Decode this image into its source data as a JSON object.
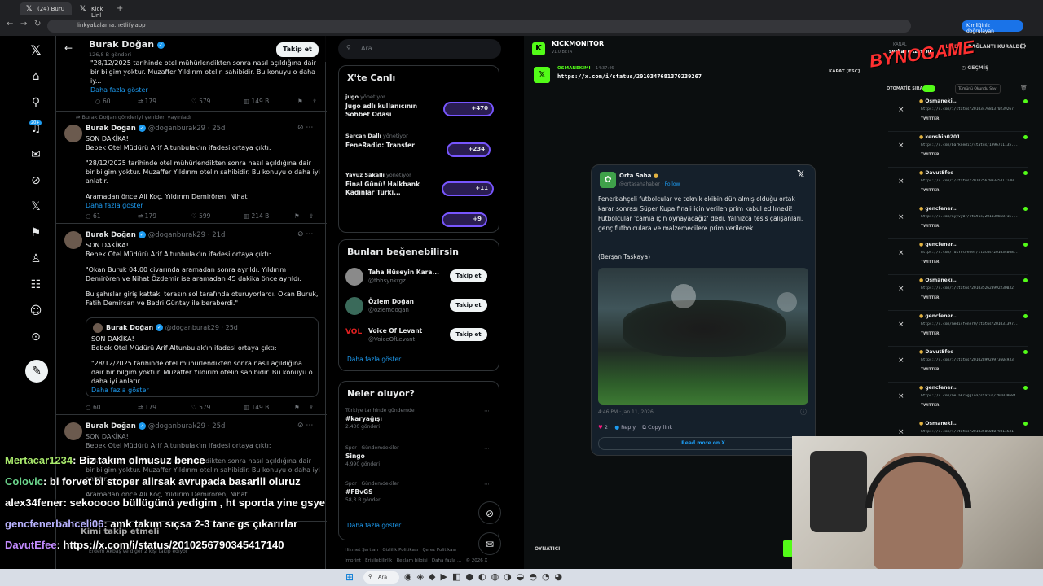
{
  "browser": {
    "tabs": [
      {
        "label": "(24) Buru"
      },
      {
        "label": "Kick Linl"
      }
    ],
    "url": "linkyakalama.netlify.app",
    "profile": "Kimliğiniz doğrulayan"
  },
  "timeline": {
    "header_name": "Burak Doğan",
    "header_sub": "126,8 B gönderi",
    "follow_label": "Takip et",
    "top_text": "\"28/12/2025 tarihinde otel mühürlendikten sonra nasıl açıldığına dair bir bilgim yoktur. Muzaffer Yıldırım otelin sahibidir. Bu konuyu o daha iy...",
    "top_more": "Daha fazla göster",
    "top_stats": {
      "replies": "60",
      "reposts": "179",
      "likes": "579",
      "views": "149 B"
    },
    "reposted_by": "Burak Doğan gönderiyi yeniden yayınladı",
    "tweets": [
      {
        "name": "Burak Doğan",
        "handle": "@doganburak29 · 25d",
        "line1": "SON DAKİKA!",
        "line2": "Bebek Otel Müdürü Arif Altunbulak'ın ifadesi ortaya çıktı:",
        "body": "\"28/12/2025 tarihinde otel mühürlendikten sonra nasıl açıldığına dair bir bilgim yoktur. Muzaffer Yıldırım otelin sahibidir. Bu konuyu o daha iyi anlatır.",
        "body2": "Aramadan önce Ali Koç, Yıldırım Demirören, Nihat",
        "more": "Daha fazla göster",
        "stats": {
          "replies": "61",
          "reposts": "179",
          "likes": "599",
          "views": "214 B"
        }
      },
      {
        "name": "Burak Doğan",
        "handle": "@doganburak29 · 21d",
        "line1": "SON DAKİKA!",
        "line2": "Bebek Otel Müdürü Arif Altunbulak'ın ifadesi ortaya çıktı:",
        "body": "\"Okan Buruk 04:00 civarında aramadan sonra ayrıldı. Yıldırım Demirören ve Nihat Özdemir ise aramadan 45 dakika önce ayrıldı.",
        "body2": "Bu şahıslar giriş kattaki terasın sol tarafında oturuyorlardı. Okan Buruk, Fatih Demircan ve Bedri Güntay ile beraberdi.\"",
        "quote": {
          "name": "Burak Doğan",
          "handle": "@doganburak29 · 25d",
          "line1": "SON DAKİKA!",
          "line2": "Bebek Otel Müdürü Arif Altunbulak'ın ifadesi ortaya çıktı:",
          "body": "\"28/12/2025 tarihinde otel mühürlendikten sonra nasıl açıldığına dair bir bilgim yoktur. Muzaffer Yıldırım otelin sahibidir. Bu konuyu o daha iyi anlatır...",
          "more": "Daha fazla göster"
        },
        "stats": {
          "replies": "60",
          "reposts": "179",
          "likes": "579",
          "views": "149 B"
        }
      },
      {
        "name": "Burak Doğan",
        "handle": "@doganburak29 · 25d",
        "line1": "SON DAKİKA!",
        "line2": "Bebek Otel Müdürü Arif Altunbulak'ın ifadesi ortaya çıktı:",
        "body": "\"28/12/2025 tarihinde otel mühürlendikten sonra nasıl açıldığına dair bir bilgim yoktur. Muzaffer Yıldırım otelin sahibidir. Bu konuyu o daha iyi anlatır.",
        "body2": "Aramadan önce Ali Koç, Yıldırım Demirören, Nihat",
        "stats": {
          "replies": "",
          "reposts": "",
          "likes": "",
          "views": ""
        }
      }
    ],
    "who_to_follow_title": "Kimi takip etmeli",
    "who_to_follow_sub": "Erdem Akbaş ve diğer 2 kişi takip ediyor"
  },
  "sidebar": {
    "search_placeholder": "Ara",
    "live_title": "X'te Canlı",
    "live": [
      {
        "host": "jugo",
        "role": "yönetiyor",
        "title": "Jugo adlı kullanıcının Sohbet Odası",
        "count": "+470"
      },
      {
        "host": "Sercan Dallı",
        "role": "yönetiyor",
        "title": "FeneRadio: Transfer",
        "count": "+234"
      },
      {
        "host": "Yavuz Sakallı",
        "role": "yönetiyor",
        "title": "Final Günü! Halkbank Kadınlar Türki...",
        "count": "+11"
      },
      {
        "host": "",
        "role": "",
        "title": "",
        "count": "+9"
      }
    ],
    "suggest_title": "Bunları beğenebilirsin",
    "suggestions": [
      {
        "name": "Taha Hüseyin Kara...",
        "handle": "@thhsynkrgz",
        "btn": "Takip et"
      },
      {
        "name": "Özlem Doğan",
        "handle": "@ozlemdogan_",
        "btn": "Takip et"
      },
      {
        "name": "Voice Of Levant",
        "handle": "@VoiceOfLevant",
        "btn": "Takip et"
      }
    ],
    "suggest_more": "Daha fazla göster",
    "trends_title": "Neler oluyor?",
    "trends": [
      {
        "context": "Türkiye tarihinde gündemde",
        "name": "#karyağışı",
        "count": "2.430 gönderi"
      },
      {
        "context": "Spor · Gündemdekiler",
        "name": "Singo",
        "count": "4.990 gönderi"
      },
      {
        "context": "Spor · Gündemdekiler",
        "name": "#FBvGS",
        "count": "58,3 B gönderi"
      }
    ],
    "trends_more": "Daha fazla göster",
    "footer": [
      "Hizmet Şartları",
      "Gizlilik Politikası",
      "Çerez Politikası",
      "İmprint",
      "Erişilebilirlik",
      "Reklam bilgisi",
      "Daha fazla ...",
      "© 2026 X Corp."
    ]
  },
  "kick": {
    "app_name": "KICKMONITOR",
    "app_version": "v1.0 BETA",
    "channel_label": "KANAL",
    "channel_name": "serkangaziogiu",
    "live_label": "LIVE",
    "connect_label": "BAĞLANTI KURALDI",
    "history_label": "GEÇMİŞ",
    "current_user": "OSMANEKIMI",
    "current_time": "14:37:46",
    "current_url": "https://x.com/i/status/2010347681370239267",
    "close_label": "KAPAT [ESC]",
    "auto_label": "OTOMATİK SIRA",
    "open_all_label": "Tümünü Okundu Say",
    "player_label": "OYNATICI",
    "queue": [
      {
        "user": "Osmaneki...",
        "url": "https://x.com/i/status/2010347681370239267"
      },
      {
        "user": "kenshin0201",
        "url": "https://x.com/barknedit/status/1996711135..."
      },
      {
        "user": "DavutEfee",
        "url": "https://x.com/i/status/2010256790345417140"
      },
      {
        "user": "gencfener...",
        "url": "https://x.com/nyyvy07/status/201030858715..."
      },
      {
        "user": "gencfener...",
        "url": "https://x.com/TukYolFener/status/201034668..."
      },
      {
        "user": "Osmaneki...",
        "url": "https://x.com/i/status/2010352623992230032"
      },
      {
        "user": "gencfener...",
        "url": "https://x.com/medisfener0/status/201031397..."
      },
      {
        "user": "DavutEfee",
        "url": "https://x.com/i/status/2010289929973604933"
      },
      {
        "user": "gencfener...",
        "url": "https://x.com/melakcaggina/status/201030684..."
      },
      {
        "user": "Osmaneki...",
        "url": "https://x.com/i/status/2010350604079314531"
      }
    ],
    "queue_btn": "TWITTER",
    "embed": {
      "name": "Orta Saha",
      "handle": "@ortasahahaber",
      "follow": "Follow",
      "text": "Fenerbahçeli futbolcular ve teknik ekibin dün almış olduğu ortak karar sonrası Süper Kupa finali için verilen prim kabul edilmedi! Futbolcular 'camia için oynayacağız' dedi. Yalnızca tesis çalışanları, genç futbolculara ve malzemecilere prim verilecek.",
      "credit": "(Berşan Taşkaya)",
      "time": "4:46 PM · Jan 11, 2026",
      "likes": "2",
      "reply": "Reply",
      "copy": "Copy link",
      "read_more": "Read more on X"
    }
  },
  "chat": [
    {
      "user": "Mertacar1234",
      "msg": ": Biz takım olmusuz bence",
      "color": "#a8e86b"
    },
    {
      "user": "Colovic",
      "msg": ": bi forvet bi stoper alirsak avrupada basarili oluruz",
      "color": "#6bd38b"
    },
    {
      "user": "alex34fener",
      "msg": ": sekooooo büllügünü yedigim , ht sporda yine gsye",
      "color": "#ffffff"
    },
    {
      "user": "gencfenerbahceli06",
      "msg": ": amk takım sıçsa 2-3 tane gs çıkarırlar",
      "color": "#b9b3ff"
    },
    {
      "user": "DavutEfee",
      "msg": ": https://x.com/i/status/2010256790345417140",
      "color": "#c38bff"
    }
  ],
  "taskbar": {
    "search": "Ara"
  },
  "colors": {
    "x_blue": "#1d9bf0",
    "kick_green": "#53fc18"
  }
}
